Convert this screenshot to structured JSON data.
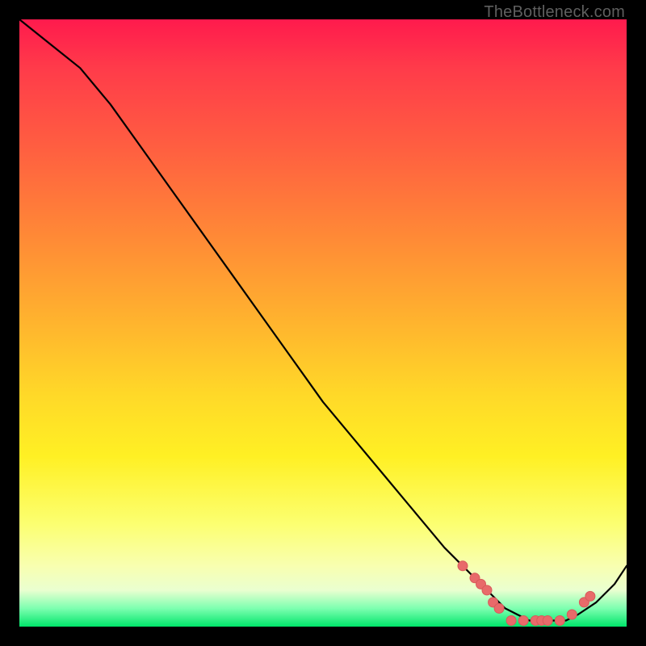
{
  "watermark": "TheBottleneck.com",
  "colors": {
    "dot": "#e86a6a",
    "curve": "#000000",
    "gradient_top": "#ff1a4d",
    "gradient_bottom": "#00e56a"
  },
  "chart_data": {
    "type": "line",
    "title": "",
    "xlabel": "",
    "ylabel": "",
    "xlim": [
      0,
      100
    ],
    "ylim": [
      0,
      100
    ],
    "grid": false,
    "legend": null,
    "series": [
      {
        "name": "bottleneck-curve",
        "x": [
          0,
          5,
          10,
          15,
          20,
          25,
          30,
          35,
          40,
          45,
          50,
          55,
          60,
          65,
          70,
          73,
          76,
          78,
          80,
          82,
          84,
          86,
          88,
          90,
          92,
          95,
          98,
          100
        ],
        "y": [
          100,
          96,
          92,
          86,
          79,
          72,
          65,
          58,
          51,
          44,
          37,
          31,
          25,
          19,
          13,
          10,
          7,
          5,
          3,
          2,
          1,
          1,
          1,
          1,
          2,
          4,
          7,
          10
        ]
      }
    ],
    "highlight_points": [
      {
        "x": 73,
        "y": 10
      },
      {
        "x": 75,
        "y": 8
      },
      {
        "x": 76,
        "y": 7
      },
      {
        "x": 77,
        "y": 6
      },
      {
        "x": 78,
        "y": 4
      },
      {
        "x": 79,
        "y": 3
      },
      {
        "x": 81,
        "y": 1
      },
      {
        "x": 83,
        "y": 1
      },
      {
        "x": 85,
        "y": 1
      },
      {
        "x": 86,
        "y": 1
      },
      {
        "x": 87,
        "y": 1
      },
      {
        "x": 89,
        "y": 1
      },
      {
        "x": 91,
        "y": 2
      },
      {
        "x": 93,
        "y": 4
      },
      {
        "x": 94,
        "y": 5
      }
    ]
  }
}
